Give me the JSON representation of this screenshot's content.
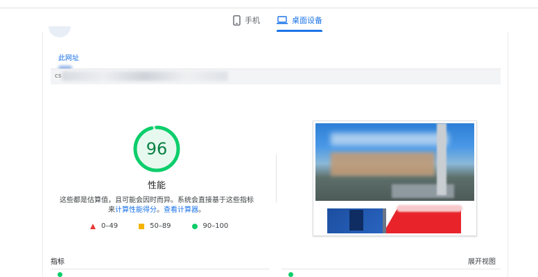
{
  "tabs": {
    "mobile_label": "手机",
    "desktop_label": "桌面设备",
    "active": "desktop"
  },
  "url_section": {
    "link_label": "此网址",
    "url_prefix": "cs"
  },
  "score": {
    "value": 96,
    "label": "性能",
    "description_line1": "这些都是估算值，且可能会因时而异。系统会直接基于这些指标",
    "description_line2_prefix": "来",
    "calc_link": "计算性能得分",
    "description_line2_middle": "。",
    "calculator_link": "查看计算器",
    "description_line2_suffix": "。",
    "color": "#0cce6b"
  },
  "legend": {
    "items": [
      {
        "label": "0–49",
        "color": "#e53935"
      },
      {
        "label": "50–89",
        "color": "#f4b400"
      },
      {
        "label": "90–100",
        "color": "#0cce6b"
      }
    ]
  },
  "metrics": {
    "header": "指标",
    "expand_label": "展开视图"
  },
  "colors": {
    "accent": "#1a73e8",
    "good": "#0cce6b",
    "average": "#f4b400",
    "poor": "#e53935"
  }
}
